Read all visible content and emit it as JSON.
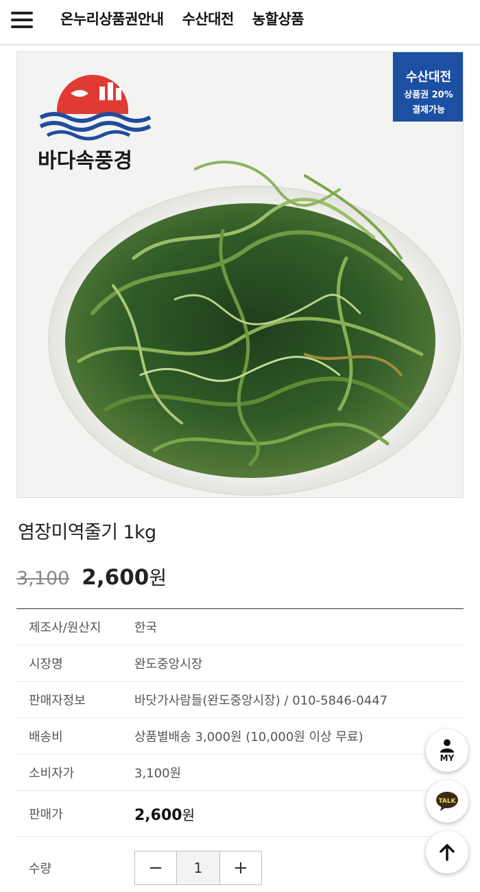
{
  "header": {
    "menu_icon": "hamburger-menu-icon",
    "nav": [
      "온누리상품권안내",
      "수산대전",
      "농할상품"
    ]
  },
  "product_image": {
    "brand_text": "바다속풍경",
    "badge": {
      "line1": "수산대전",
      "line2": "상품권 20%",
      "line3": "결제가능",
      "color": "#1d4fa3"
    }
  },
  "product": {
    "title": "염장미역줄기 1kg",
    "original_price": "3,100",
    "sale_price": "2,600",
    "currency_unit": "원"
  },
  "info": {
    "rows": [
      {
        "label": "제조사/원산지",
        "value": "한국"
      },
      {
        "label": "시장명",
        "value": "완도중앙시장"
      },
      {
        "label": "판매자정보",
        "value": "바닷가사람들(완도중앙시장) / 010-5846-0447"
      },
      {
        "label": "배송비",
        "value": "상품별배송 3,000원 (10,000원 이상 무료)"
      },
      {
        "label": "소비자가",
        "value": "3,100원"
      }
    ],
    "sale_label": "판매가",
    "sale_value": "2,600",
    "sale_unit": "원",
    "qty_label": "수량",
    "qty_minus": "−",
    "qty_value": "1",
    "qty_plus": "+"
  },
  "floating": {
    "my_label": "MY",
    "talk_label": "TALK",
    "top_icon": "arrow-up-icon",
    "talk_color": "#3b2a1a",
    "talk_text_color": "#f7d84a"
  }
}
